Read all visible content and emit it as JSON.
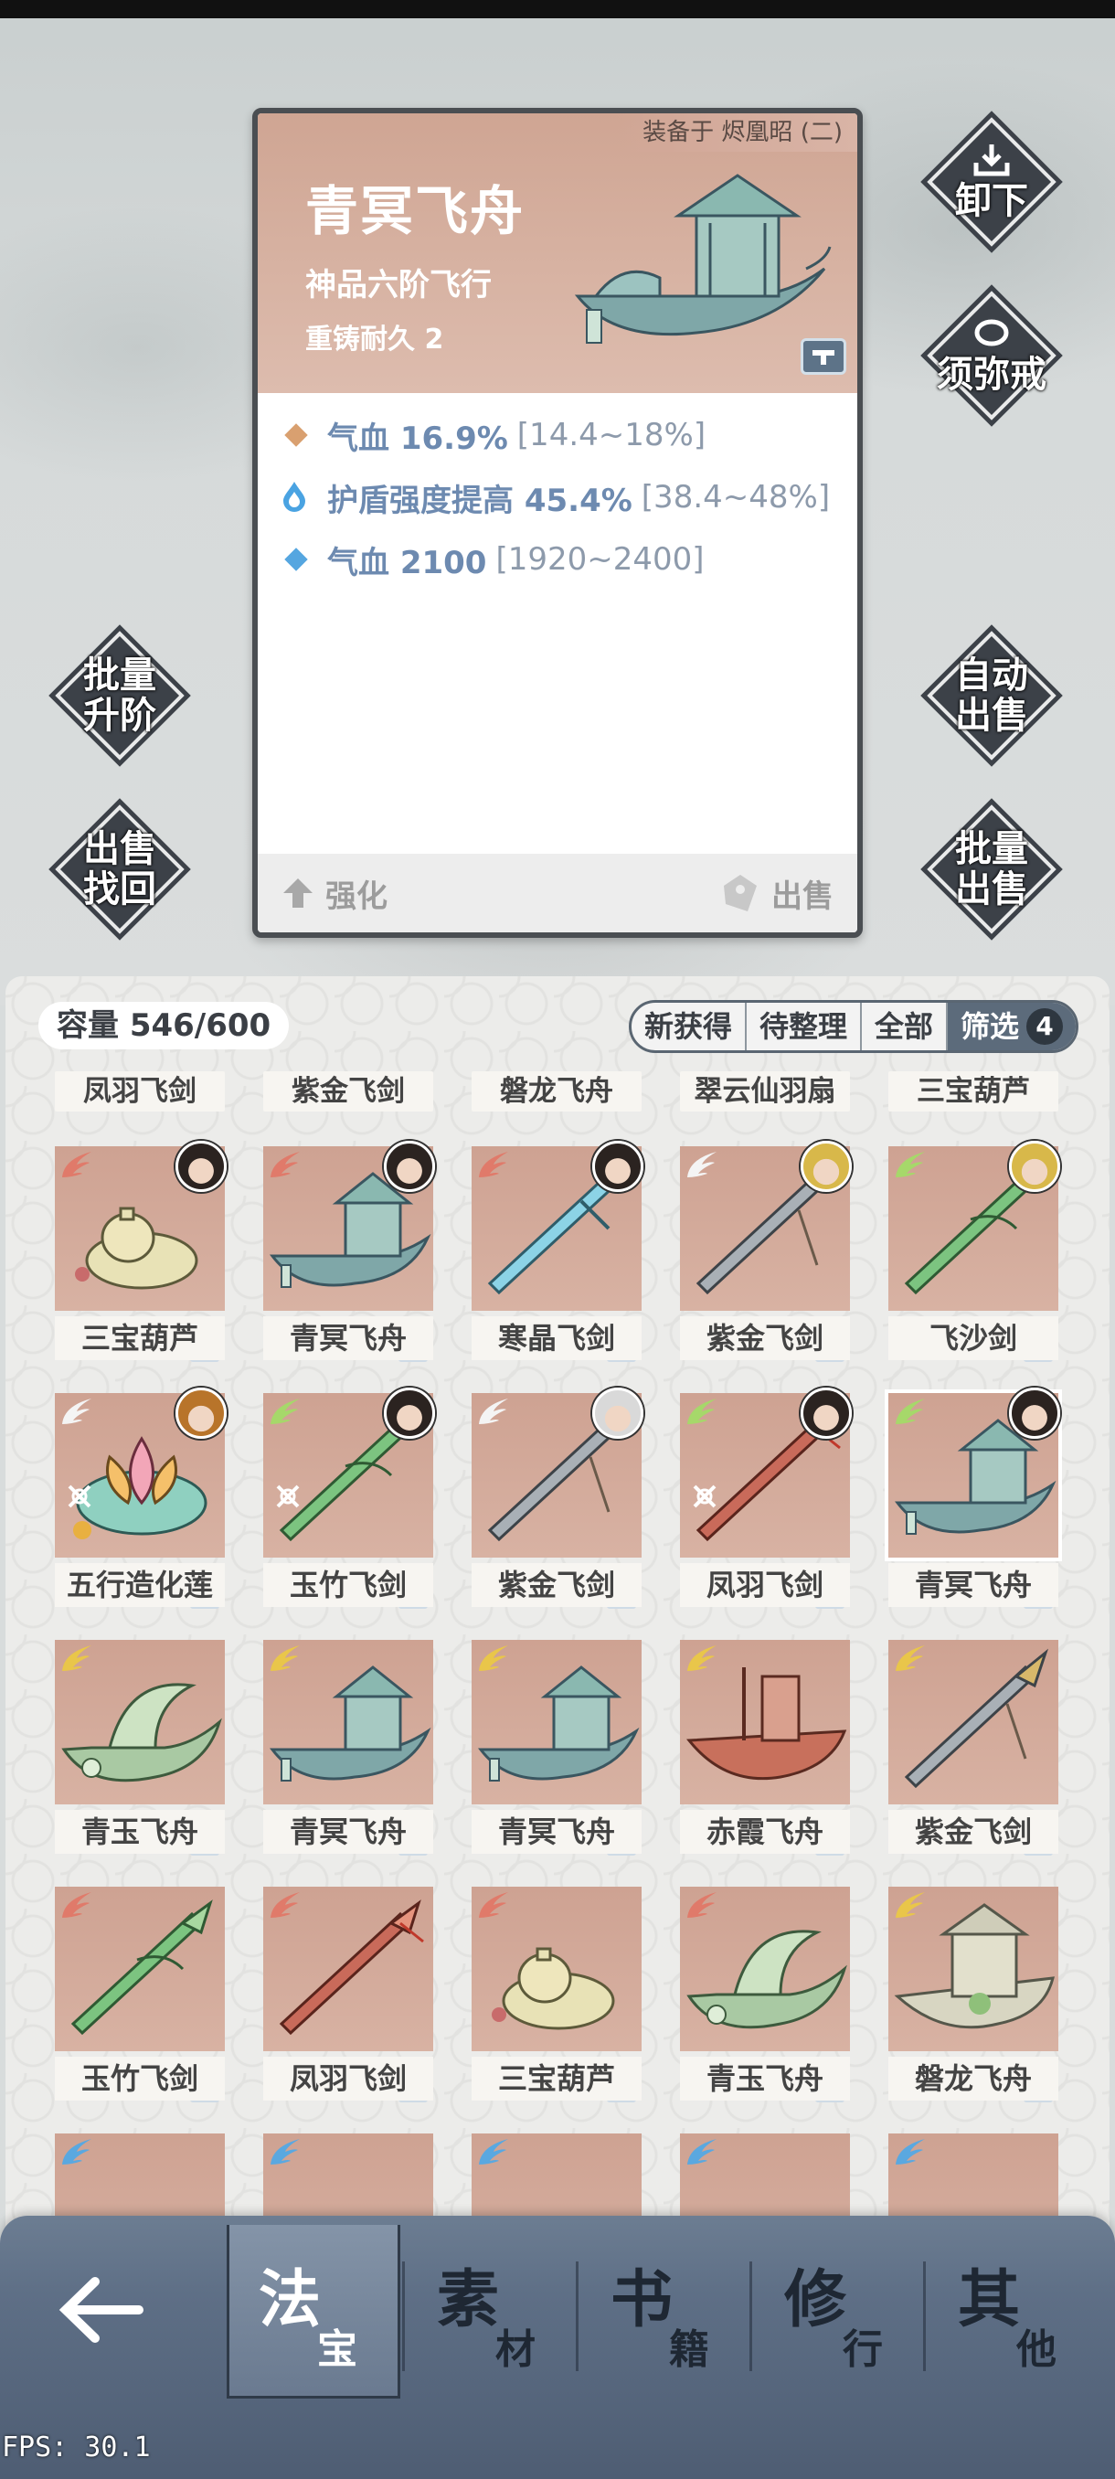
{
  "card": {
    "equipped": "装备于 烬凰昭 (二)",
    "title": "青冥飞舟",
    "subtitle": "神品六阶飞行",
    "durability": "重铸耐久 2",
    "stats": [
      {
        "icon": "orange-diamond-icon",
        "text": "气血 16.9%",
        "range": "[14.4~18%]"
      },
      {
        "icon": "blue-drop-icon",
        "text": "护盾强度提高 45.4%",
        "range": "[38.4~48%]"
      },
      {
        "icon": "blue-diamond-icon",
        "text": "气血 2100",
        "range": "[1920~2400]"
      }
    ],
    "enhance_label": "强化",
    "sell_label": "出售"
  },
  "side_buttons": {
    "unequip": "卸下",
    "sumeru": "须弥戒",
    "batch_upgrade_1": "批量",
    "batch_upgrade_2": "升阶",
    "auto_sell_1": "自动",
    "auto_sell_2": "出售",
    "recover_1": "出售",
    "recover_2": "找回",
    "batch_sell_1": "批量",
    "batch_sell_2": "出售"
  },
  "inventory": {
    "capacity": "容量 546/600",
    "filters": [
      "新获得",
      "待整理",
      "全部"
    ],
    "filter_active": "筛选",
    "filter_count": "4",
    "top_labels": [
      "凤羽飞剑",
      "紫金飞剑",
      "磐龙飞舟",
      "翠云仙羽扇",
      "三宝葫芦"
    ],
    "rows": [
      [
        {
          "name": "三宝葫芦",
          "wing": "#e07a6a",
          "art": "gourd",
          "portrait": "dark"
        },
        {
          "name": "青冥飞舟",
          "wing": "#e07a6a",
          "art": "boat-blue",
          "portrait": "dark"
        },
        {
          "name": "寒晶飞剑",
          "wing": "#e07a6a",
          "art": "sword-ice",
          "portrait": "dark"
        },
        {
          "name": "紫金飞剑",
          "wing": "#f4f4f4",
          "art": "sword-gray",
          "portrait": "gold"
        },
        {
          "name": "飞沙剑",
          "wing": "#a6d86a",
          "art": "sword-green",
          "portrait": "gold"
        }
      ],
      [
        {
          "name": "五行造化莲",
          "wing": "#f4f4f4",
          "art": "lotus",
          "portrait": "orange"
        },
        {
          "name": "玉竹飞剑",
          "wing": "#a6d86a",
          "art": "sword-green",
          "portrait": "dark"
        },
        {
          "name": "紫金飞剑",
          "wing": "#f4f4f4",
          "art": "sword-gray",
          "portrait": "white"
        },
        {
          "name": "凤羽飞剑",
          "wing": "#a6d86a",
          "art": "sword-red",
          "portrait": "dark"
        },
        {
          "name": "青冥飞舟",
          "wing": "#a6d86a",
          "art": "boat-blue",
          "portrait": "dark"
        }
      ],
      [
        {
          "name": "青玉飞舟",
          "wing": "#e9c64a",
          "art": "boat-green",
          "portrait": ""
        },
        {
          "name": "青冥飞舟",
          "wing": "#e9c64a",
          "art": "boat-blue",
          "portrait": ""
        },
        {
          "name": "青冥飞舟",
          "wing": "#e9c64a",
          "art": "boat-blue",
          "portrait": ""
        },
        {
          "name": "赤霞飞舟",
          "wing": "#e9c64a",
          "art": "boat-red",
          "portrait": ""
        },
        {
          "name": "紫金飞剑",
          "wing": "#e9c64a",
          "art": "sword-gray",
          "portrait": ""
        }
      ],
      [
        {
          "name": "玉竹飞剑",
          "wing": "#e07a6a",
          "art": "sword-green",
          "portrait": ""
        },
        {
          "name": "凤羽飞剑",
          "wing": "#e07a6a",
          "art": "sword-red",
          "portrait": ""
        },
        {
          "name": "三宝葫芦",
          "wing": "#e07a6a",
          "art": "gourd",
          "portrait": ""
        },
        {
          "name": "青玉飞舟",
          "wing": "#e07a6a",
          "art": "boat-green",
          "portrait": ""
        },
        {
          "name": "磐龙飞舟",
          "wing": "#e9c64a",
          "art": "boat-stone",
          "portrait": ""
        }
      ]
    ],
    "partial_row_wings": [
      "#5aa8e0",
      "#5aa8e0",
      "#5aa8e0",
      "#5aa8e0",
      "#5aa8e0"
    ]
  },
  "nav": {
    "tabs": [
      {
        "big": "法",
        "small": "宝"
      },
      {
        "big": "素",
        "small": "材"
      },
      {
        "big": "书",
        "small": "籍"
      },
      {
        "big": "修",
        "small": "行"
      },
      {
        "big": "其",
        "small": "他"
      }
    ]
  },
  "fps": "FPS: 30.1"
}
